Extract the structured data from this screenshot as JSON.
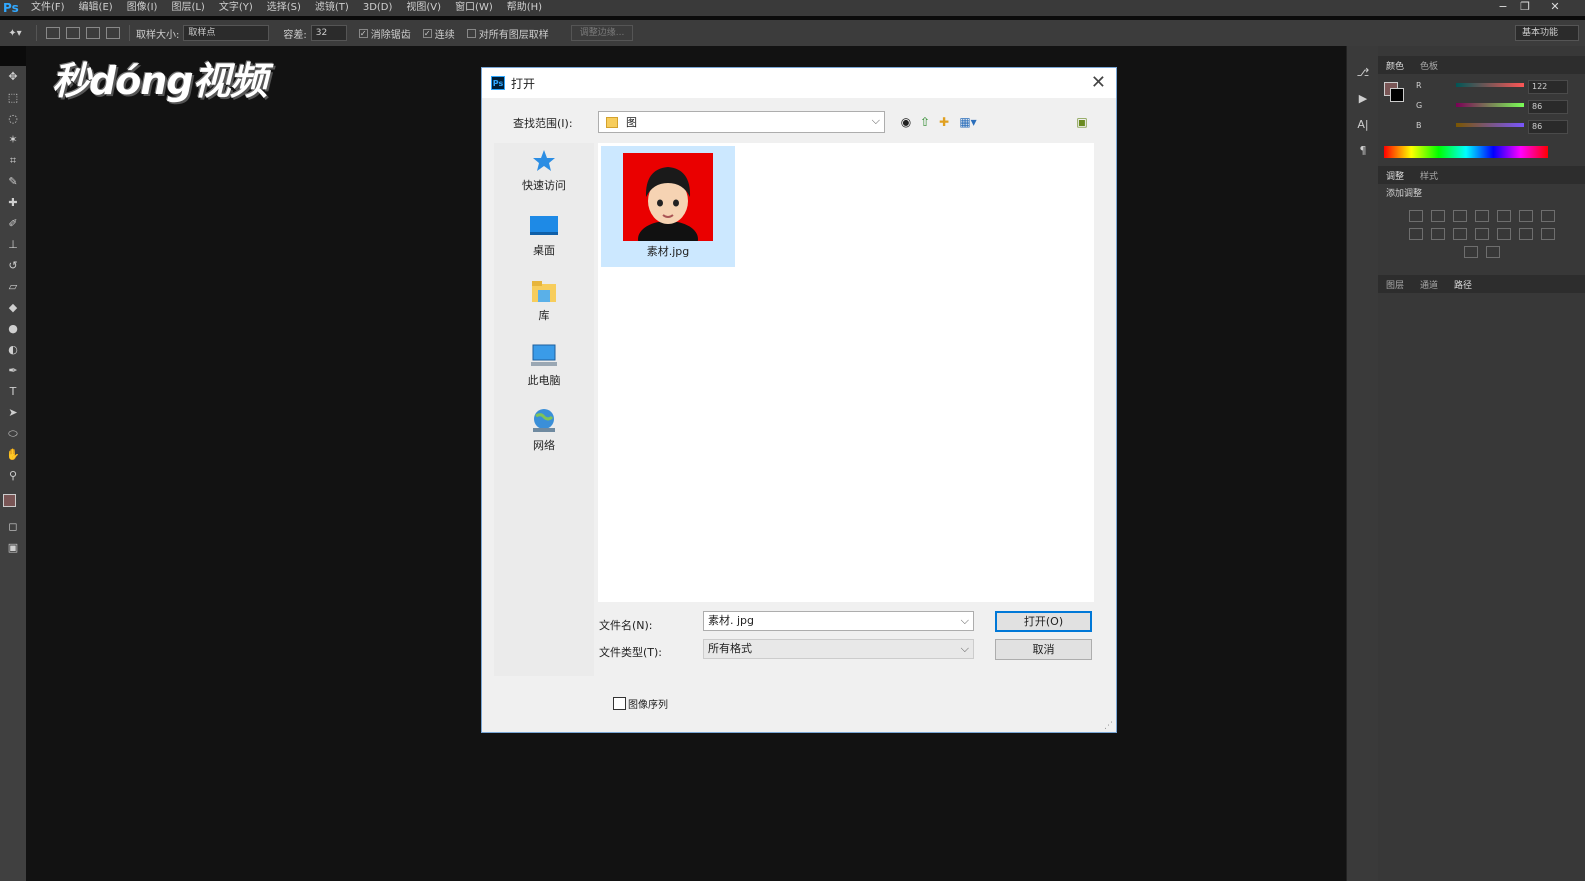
{
  "app": {
    "logo": "Ps"
  },
  "menu": [
    "文件(F)",
    "编辑(E)",
    "图像(I)",
    "图层(L)",
    "文字(Y)",
    "选择(S)",
    "滤镜(T)",
    "3D(D)",
    "视图(V)",
    "窗口(W)",
    "帮助(H)"
  ],
  "options": {
    "sample_size_label": "取样大小:",
    "sample_size_value": "取样点",
    "tolerance_label": "容差:",
    "tolerance_value": "32",
    "antialias_label": "消除锯齿",
    "contiguous_label": "连续",
    "sample_all_label": "对所有图层取样",
    "refine_edge_label": "调整边缘...",
    "workspace": "基本功能"
  },
  "watermark": "秒dóng视频",
  "color_panel": {
    "tabs": [
      "颜色",
      "色板"
    ],
    "rows": [
      {
        "label": "R",
        "value": "122"
      },
      {
        "label": "G",
        "value": "86"
      },
      {
        "label": "B",
        "value": "86"
      }
    ],
    "foreground": "#7a5656"
  },
  "adjust_panel": {
    "tabs": [
      "调整",
      "样式"
    ],
    "title": "添加调整"
  },
  "layers_panel": {
    "tabs": [
      "图层",
      "通道",
      "路径"
    ]
  },
  "dialog": {
    "title": "打开",
    "look_in_label": "查找范围(I):",
    "look_in_value": "图",
    "places": [
      {
        "label": "快速访问",
        "icon": "star-icon"
      },
      {
        "label": "桌面",
        "icon": "desktop-icon"
      },
      {
        "label": "库",
        "icon": "library-icon"
      },
      {
        "label": "此电脑",
        "icon": "computer-icon"
      },
      {
        "label": "网络",
        "icon": "network-icon"
      }
    ],
    "files": [
      {
        "name": "素材.jpg"
      }
    ],
    "filename_label": "文件名(N):",
    "filename_value": "素材. jpg",
    "filetype_label": "文件类型(T):",
    "filetype_value": "所有格式",
    "open_button": "打开(O)",
    "cancel_button": "取消",
    "image_sequence_label": "图像序列"
  }
}
